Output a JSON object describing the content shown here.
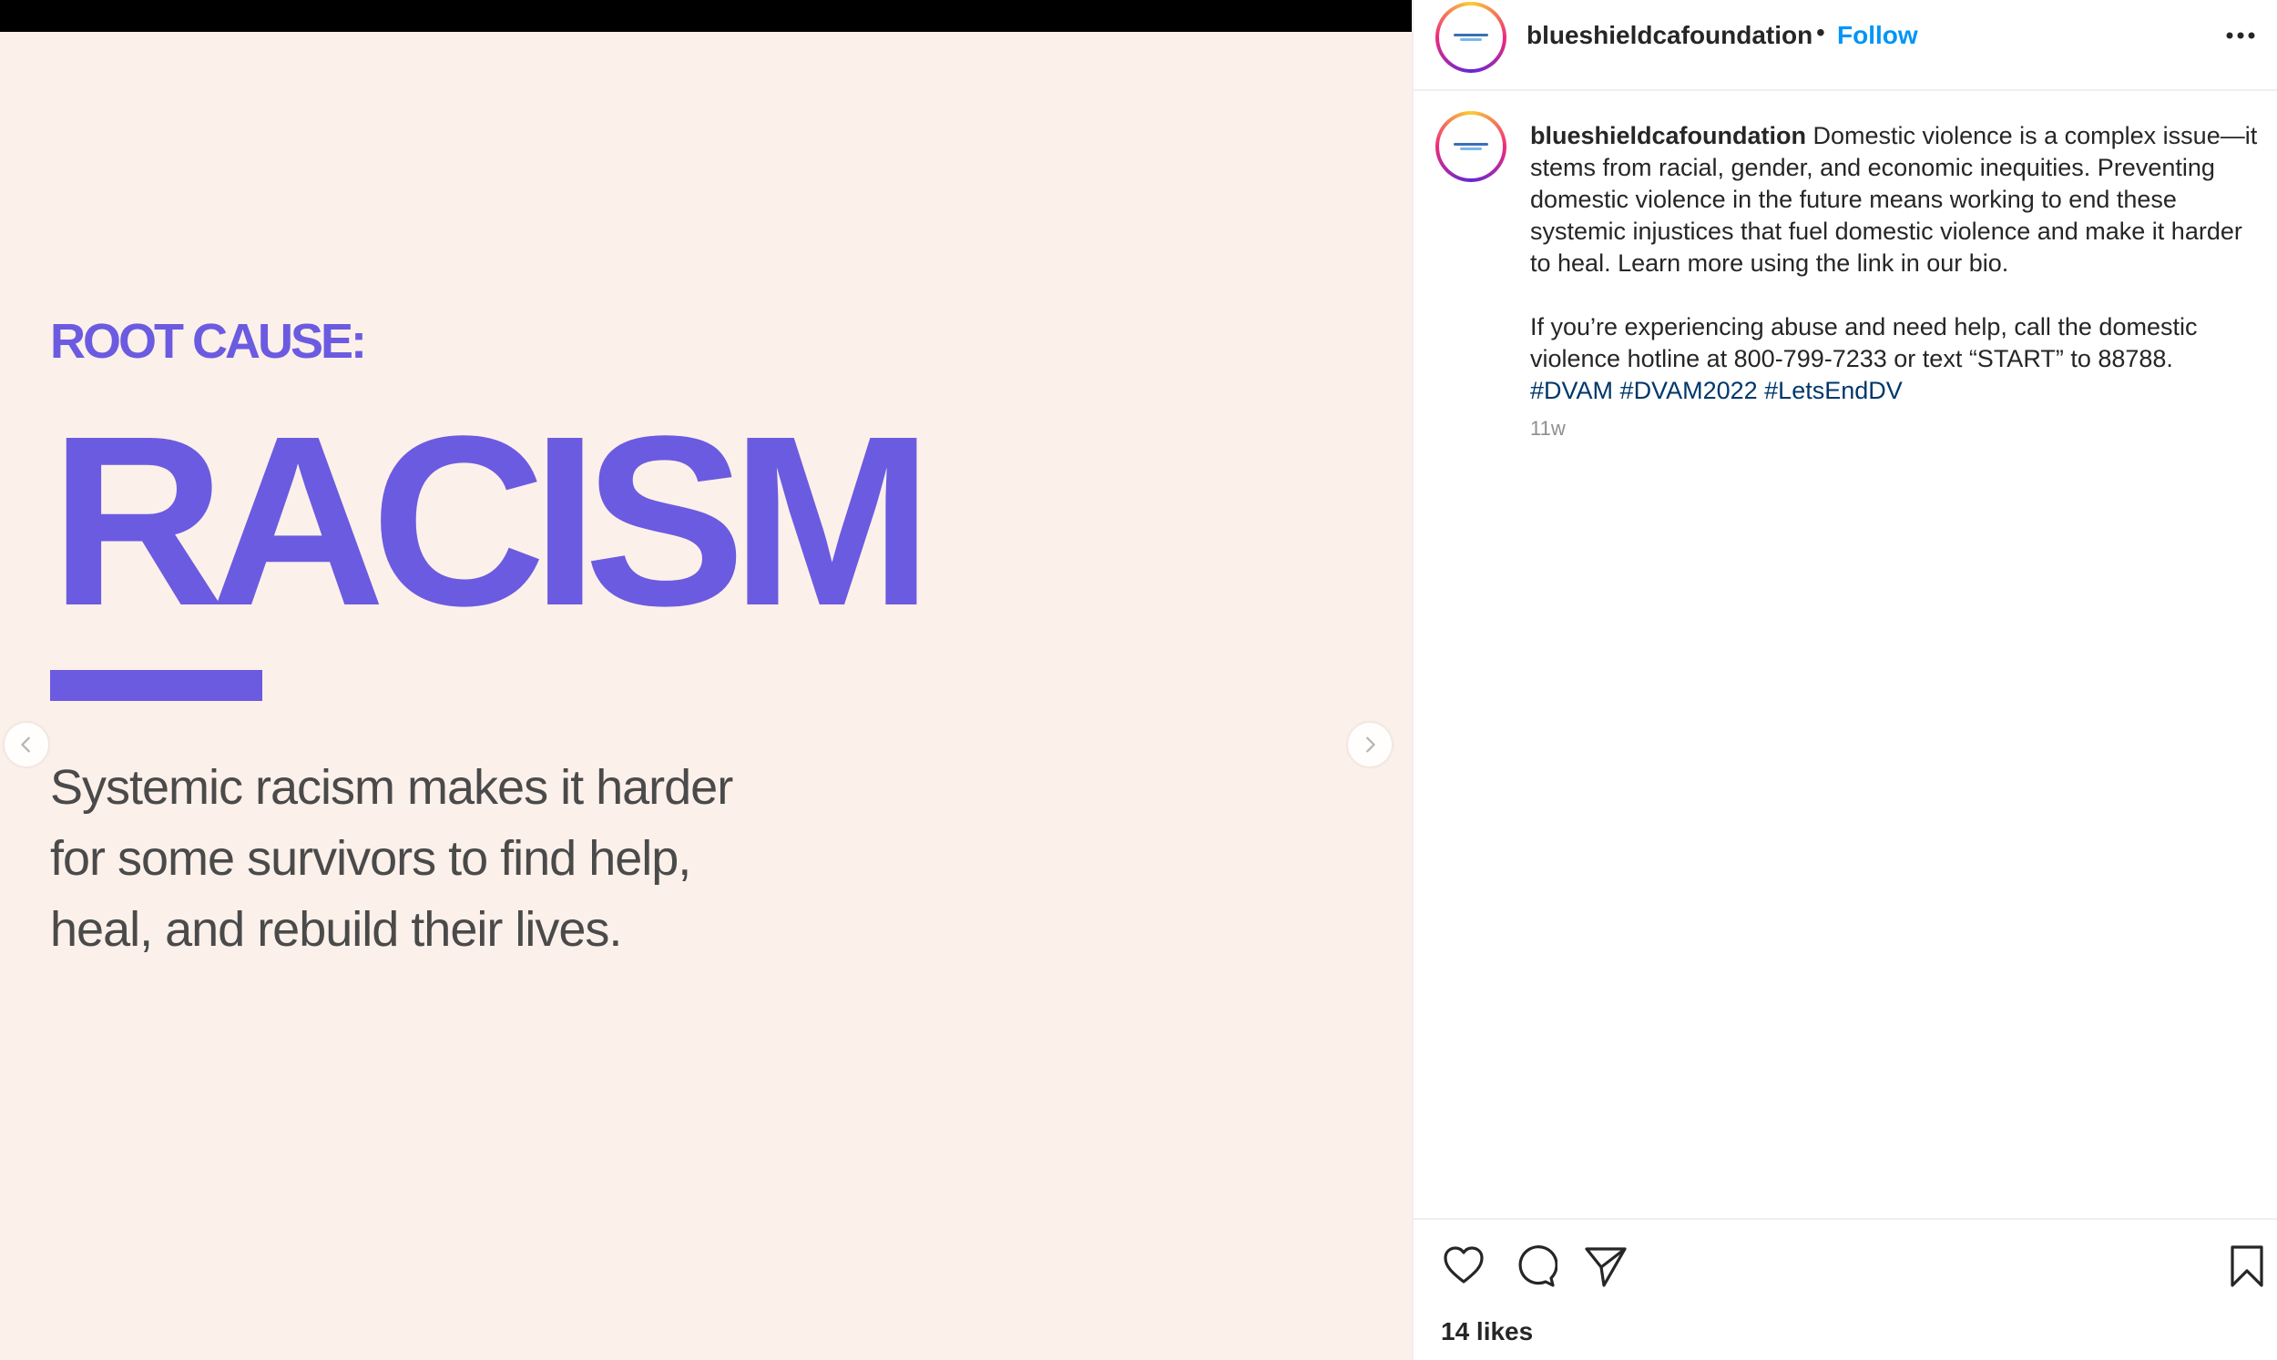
{
  "slide": {
    "eyebrow": "ROOT CAUSE:",
    "title": "RACISM",
    "body": "Systemic racism makes it harder for some survivors to find help, heal, and rebuild their lives.",
    "accent_color": "#6b5be0",
    "background_color": "#fcf0ea"
  },
  "carousel": {
    "prev_icon": "chevron-left-icon",
    "next_icon": "chevron-right-icon"
  },
  "header": {
    "username": "blueshieldcafoundation",
    "separator": "•",
    "follow_label": "Follow",
    "more_icon": "more-horizontal-icon"
  },
  "caption": {
    "username": "blueshieldcafoundation",
    "paragraph1": "Domestic violence is a complex issue—it stems from racial, gender, and economic inequities. Preventing domestic violence in the future means working to end these systemic injustices that fuel domestic violence and make it harder to heal. Learn more using the link in our bio.",
    "paragraph2": "If you’re experiencing abuse and need help, call the domestic violence hotline at 800-799-7233 or text “START” to 88788.",
    "hashtags": [
      "#DVAM",
      "#DVAM2022",
      "#LetsEndDV"
    ],
    "time_ago": "11w"
  },
  "actions": {
    "icons": [
      "heart-icon",
      "comment-icon",
      "share-icon",
      "bookmark-icon"
    ],
    "likes_text": "14 likes"
  },
  "colors": {
    "link_blue": "#0095f6",
    "hashtag_blue": "#00376b",
    "text": "#262626",
    "muted": "#8e8e8e"
  }
}
